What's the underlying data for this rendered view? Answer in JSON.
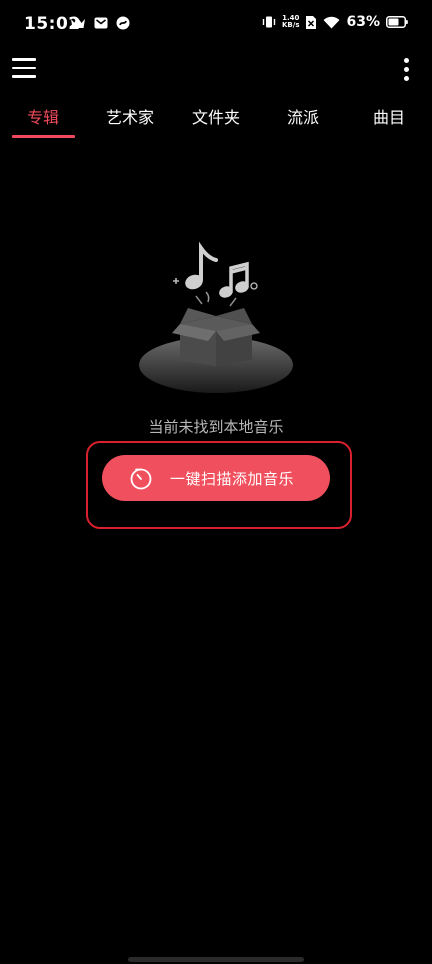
{
  "status_bar": {
    "time": "15:02",
    "net_speed_value": "1.40",
    "net_speed_unit": "KB/s",
    "battery_percent": "63%"
  },
  "toolbar": {
    "menu_icon": "hamburger-menu-icon",
    "more_icon": "more-vertical-icon"
  },
  "tabs": [
    {
      "label": "专辑",
      "active": true
    },
    {
      "label": "艺术家",
      "active": false
    },
    {
      "label": "文件夹",
      "active": false
    },
    {
      "label": "流派",
      "active": false
    },
    {
      "label": "曲目",
      "active": false
    }
  ],
  "empty_state": {
    "message": "当前未找到本地音乐",
    "scan_button_label": "一键扫描添加音乐",
    "illustration_icon": "empty-music-box-icon",
    "button_icon": "timer-scan-icon"
  },
  "colors": {
    "accent": "#ef4a5c",
    "button": "#f0505d",
    "highlight": "#d8212c",
    "background": "#000000"
  }
}
